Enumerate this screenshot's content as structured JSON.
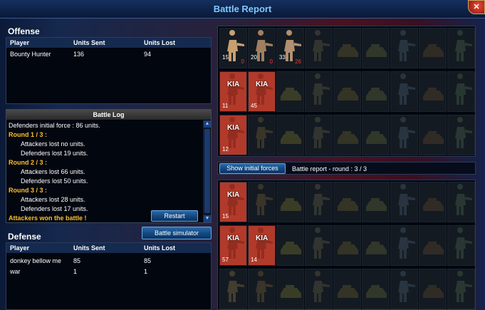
{
  "title": "Battle Report",
  "offense": {
    "heading": "Offense",
    "columns": [
      "Player",
      "Units Sent",
      "Units Lost"
    ],
    "rows": [
      {
        "player": "Bounty Hunter",
        "sent": "136",
        "lost": "94"
      }
    ]
  },
  "battle_log": {
    "heading": "Battle Log",
    "lines": [
      {
        "text": "Defenders initial force : 86 units.",
        "kind": "plain"
      },
      {
        "text": "Round 1 / 3 :",
        "kind": "round"
      },
      {
        "text": "Attackers lost no units.",
        "kind": "indent"
      },
      {
        "text": "Defenders lost 19 units.",
        "kind": "indent"
      },
      {
        "text": "Round 2 / 3 :",
        "kind": "round"
      },
      {
        "text": "Attackers lost 66 units.",
        "kind": "indent"
      },
      {
        "text": "Defenders lost 50 units.",
        "kind": "indent"
      },
      {
        "text": "Round 3 / 3 :",
        "kind": "round"
      },
      {
        "text": "Attackers lost 28 units.",
        "kind": "indent"
      },
      {
        "text": "Defenders lost 17 units.",
        "kind": "indent"
      },
      {
        "text": "Attackers won the battle !",
        "kind": "victory"
      }
    ],
    "restart_label": "Restart"
  },
  "simulator_label": "Battle simulator",
  "defense": {
    "heading": "Defense",
    "columns": [
      "Player",
      "Units Sent",
      "Units Lost"
    ],
    "rows": [
      {
        "player": "donkey bellow me",
        "sent": "85",
        "lost": "85"
      },
      {
        "player": "war",
        "sent": "1",
        "lost": "1"
      }
    ]
  },
  "show_initial_forces_label": "Show initial forces",
  "round_status": "Battle report - round : 3 / 3",
  "attacker_grid": [
    [
      {
        "sent": "15",
        "lost": "0",
        "state": "filled",
        "icon": "soldier-icon"
      },
      {
        "sent": "20",
        "lost": "0",
        "state": "filled",
        "icon": "gunner-icon"
      },
      {
        "sent": "33",
        "lost": "26",
        "state": "filled",
        "icon": "mech-icon"
      },
      {
        "state": "empty"
      },
      {
        "state": "empty"
      },
      {
        "state": "empty"
      },
      {
        "state": "empty"
      },
      {
        "state": "empty"
      },
      {
        "state": "empty"
      }
    ],
    [
      {
        "sent": "11",
        "kia": "KIA",
        "state": "kia",
        "icon": "soldier-icon"
      },
      {
        "sent": "45",
        "kia": "KIA",
        "state": "kia",
        "icon": "soldier-icon"
      },
      {
        "state": "empty"
      },
      {
        "state": "empty"
      },
      {
        "state": "empty"
      },
      {
        "state": "empty"
      },
      {
        "state": "empty"
      },
      {
        "state": "empty"
      },
      {
        "state": "empty"
      }
    ],
    [
      {
        "sent": "12",
        "kia": "KIA",
        "state": "kia",
        "icon": "soldier-icon"
      },
      {
        "state": "empty"
      },
      {
        "state": "empty"
      },
      {
        "state": "empty"
      },
      {
        "state": "empty"
      },
      {
        "state": "empty"
      },
      {
        "state": "empty"
      },
      {
        "state": "empty"
      },
      {
        "state": "empty"
      }
    ]
  ],
  "defender_grid": [
    [
      {
        "sent": "15",
        "kia": "KIA",
        "state": "kia",
        "icon": "soldier-icon"
      },
      {
        "state": "empty"
      },
      {
        "state": "empty"
      },
      {
        "state": "empty"
      },
      {
        "state": "empty"
      },
      {
        "state": "empty"
      },
      {
        "state": "empty"
      },
      {
        "state": "empty"
      },
      {
        "state": "empty"
      }
    ],
    [
      {
        "sent": "57",
        "kia": "KIA",
        "state": "kia",
        "icon": "soldier-icon"
      },
      {
        "sent": "14",
        "kia": "KIA",
        "state": "kia",
        "icon": "soldier-icon"
      },
      {
        "state": "empty"
      },
      {
        "state": "empty"
      },
      {
        "state": "empty"
      },
      {
        "state": "empty"
      },
      {
        "state": "empty"
      },
      {
        "state": "empty"
      },
      {
        "state": "empty"
      }
    ],
    [
      {
        "state": "empty"
      },
      {
        "state": "empty"
      },
      {
        "state": "empty"
      },
      {
        "state": "empty"
      },
      {
        "state": "empty"
      },
      {
        "state": "empty"
      },
      {
        "state": "empty"
      },
      {
        "state": "empty"
      },
      {
        "state": "empty"
      }
    ]
  ],
  "colors": {
    "accent": "#7fc8ff",
    "round": "#ffbf2a",
    "lost": "#ff3030",
    "kia": "#b23a2a"
  }
}
